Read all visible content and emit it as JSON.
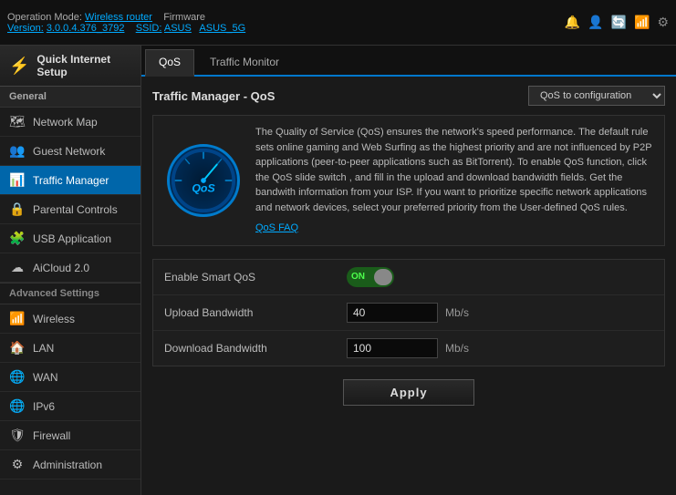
{
  "topbar": {
    "op_mode_label": "Operation Mode:",
    "op_mode_value": "Wireless router",
    "firmware_label": "Firmware",
    "version_label": "Version:",
    "version_value": "3.0.0.4.376_3792",
    "ssid_label": "SSID:",
    "ssid_value": "ASUS",
    "ssid_5g_value": "ASUS_5G"
  },
  "tabs": [
    {
      "id": "qos",
      "label": "QoS",
      "active": true
    },
    {
      "id": "traffic-monitor",
      "label": "Traffic Monitor",
      "active": false
    }
  ],
  "sidebar": {
    "quick_setup_label": "Quick Internet Setup",
    "general_header": "General",
    "items_general": [
      {
        "id": "network-map",
        "label": "Network Map",
        "icon": "🗺"
      },
      {
        "id": "guest-network",
        "label": "Guest Network",
        "icon": "👥"
      },
      {
        "id": "traffic-manager",
        "label": "Traffic Manager",
        "icon": "📊",
        "active": true
      },
      {
        "id": "parental-controls",
        "label": "Parental Controls",
        "icon": "🔒"
      },
      {
        "id": "usb-application",
        "label": "USB Application",
        "icon": "🧩"
      },
      {
        "id": "aicloud",
        "label": "AiCloud 2.0",
        "icon": "☁"
      }
    ],
    "advanced_header": "Advanced Settings",
    "items_advanced": [
      {
        "id": "wireless",
        "label": "Wireless",
        "icon": "📶"
      },
      {
        "id": "lan",
        "label": "LAN",
        "icon": "🏠"
      },
      {
        "id": "wan",
        "label": "WAN",
        "icon": "🌐"
      },
      {
        "id": "ipv6",
        "label": "IPv6",
        "icon": "🌐"
      },
      {
        "id": "firewall",
        "label": "Firewall",
        "icon": "🛡"
      },
      {
        "id": "administration",
        "label": "Administration",
        "icon": "⚙"
      }
    ]
  },
  "page": {
    "title": "Traffic Manager - QoS",
    "dropdown_value": "QoS to configuration",
    "qos_logo_text": "QoS",
    "description": "The Quality of Service (QoS) ensures the network's speed performance. The default rule sets online gaming and Web Surfing as the highest priority and are not influenced by P2P applications (peer-to-peer applications such as BitTorrent). To enable QoS function, click the QoS slide switch , and fill in the upload and download bandwidth fields. Get the bandwith information from your ISP.\nIf you want to prioritize specific network applications and network devices, select your preferred priority from the User-defined QoS rules.",
    "faq_link": "QoS FAQ",
    "form": {
      "enable_smart_qos_label": "Enable Smart QoS",
      "toggle_state": "ON",
      "upload_bandwidth_label": "Upload Bandwidth",
      "upload_bandwidth_value": "40",
      "upload_bandwidth_unit": "Mb/s",
      "download_bandwidth_label": "Download Bandwidth",
      "download_bandwidth_value": "100",
      "download_bandwidth_unit": "Mb/s"
    },
    "apply_button": "Apply"
  }
}
